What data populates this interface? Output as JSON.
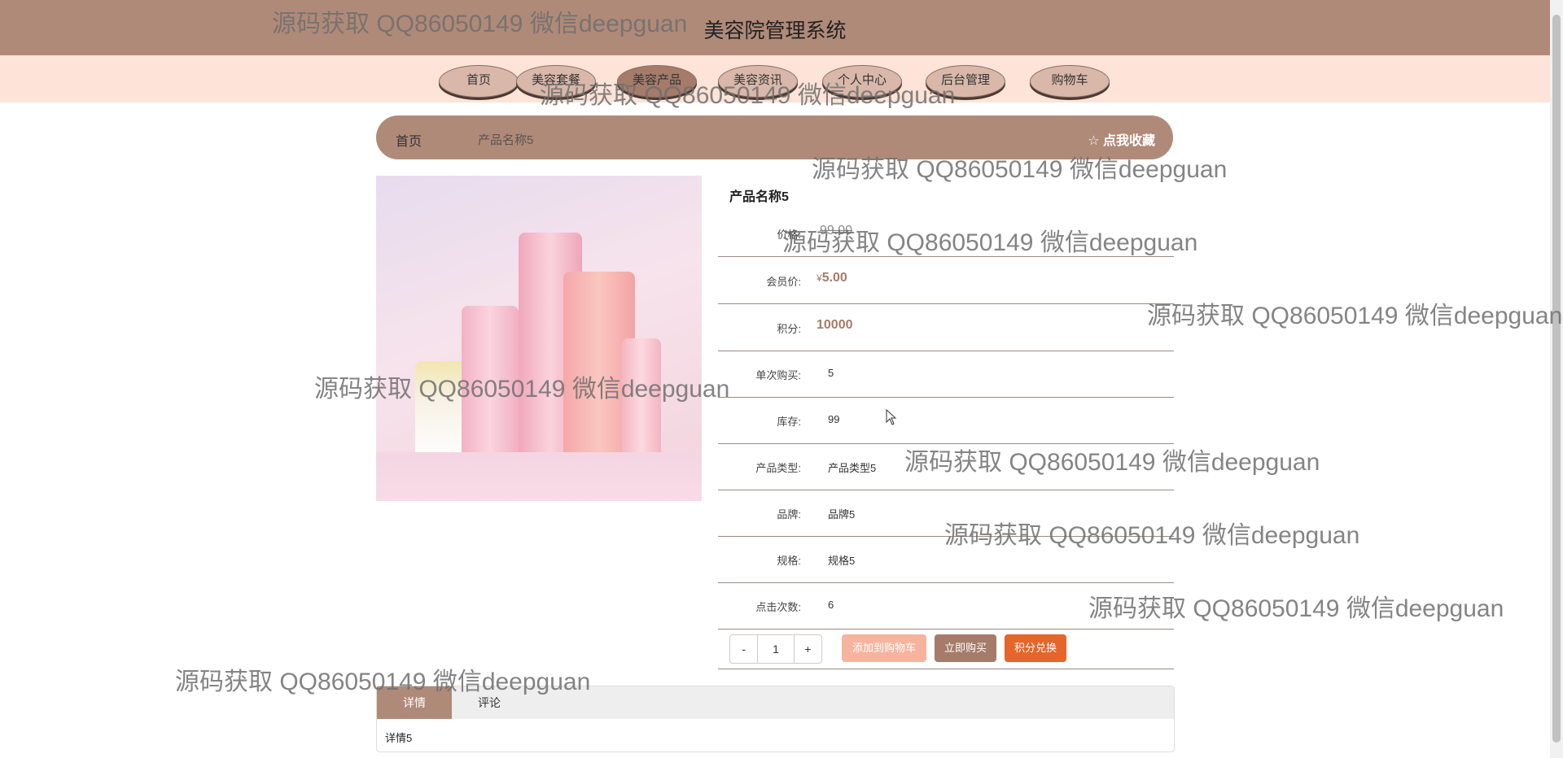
{
  "header": {
    "title": "美容院管理系统"
  },
  "nav": {
    "items": [
      {
        "label": "首页",
        "active": false
      },
      {
        "label": "美容套餐",
        "active": false
      },
      {
        "label": "美容产品",
        "active": true
      },
      {
        "label": "美容资讯",
        "active": false
      },
      {
        "label": "个人中心",
        "active": false
      },
      {
        "label": "后台管理",
        "active": false
      },
      {
        "label": "购物车",
        "active": false
      }
    ]
  },
  "breadcrumb": {
    "home": "首页",
    "current": "产品名称5",
    "favorite": "☆ 点我收藏"
  },
  "product": {
    "name": "产品名称5",
    "rows": [
      {
        "label": "价格:",
        "value": "99.00"
      },
      {
        "label": "会员价:",
        "currency": "¥",
        "value": "5.00"
      },
      {
        "label": "积分:",
        "value": "10000"
      },
      {
        "label": "单次购买:",
        "value": "5"
      },
      {
        "label": "库存:",
        "value": "99"
      },
      {
        "label": "产品类型:",
        "value": "产品类型5"
      },
      {
        "label": "品牌:",
        "value": "品牌5"
      },
      {
        "label": "规格:",
        "value": "规格5"
      },
      {
        "label": "点击次数:",
        "value": "6"
      }
    ]
  },
  "quantity": {
    "minus": "-",
    "value": "1",
    "plus": "+"
  },
  "actions": {
    "add_cart": "添加到购物车",
    "buy_now": "立即购买",
    "points_exchange": "积分兑换"
  },
  "tabs": {
    "items": [
      "详情",
      "评论"
    ],
    "content": "详情5"
  },
  "watermark": "源码获取 QQ86050149 微信deepguan",
  "colors": {
    "header": "#b08a78",
    "nav_band": "#fde3d8",
    "accent": "#a57b6a",
    "orange": "#e5652a",
    "peach": "#f6b49e"
  }
}
